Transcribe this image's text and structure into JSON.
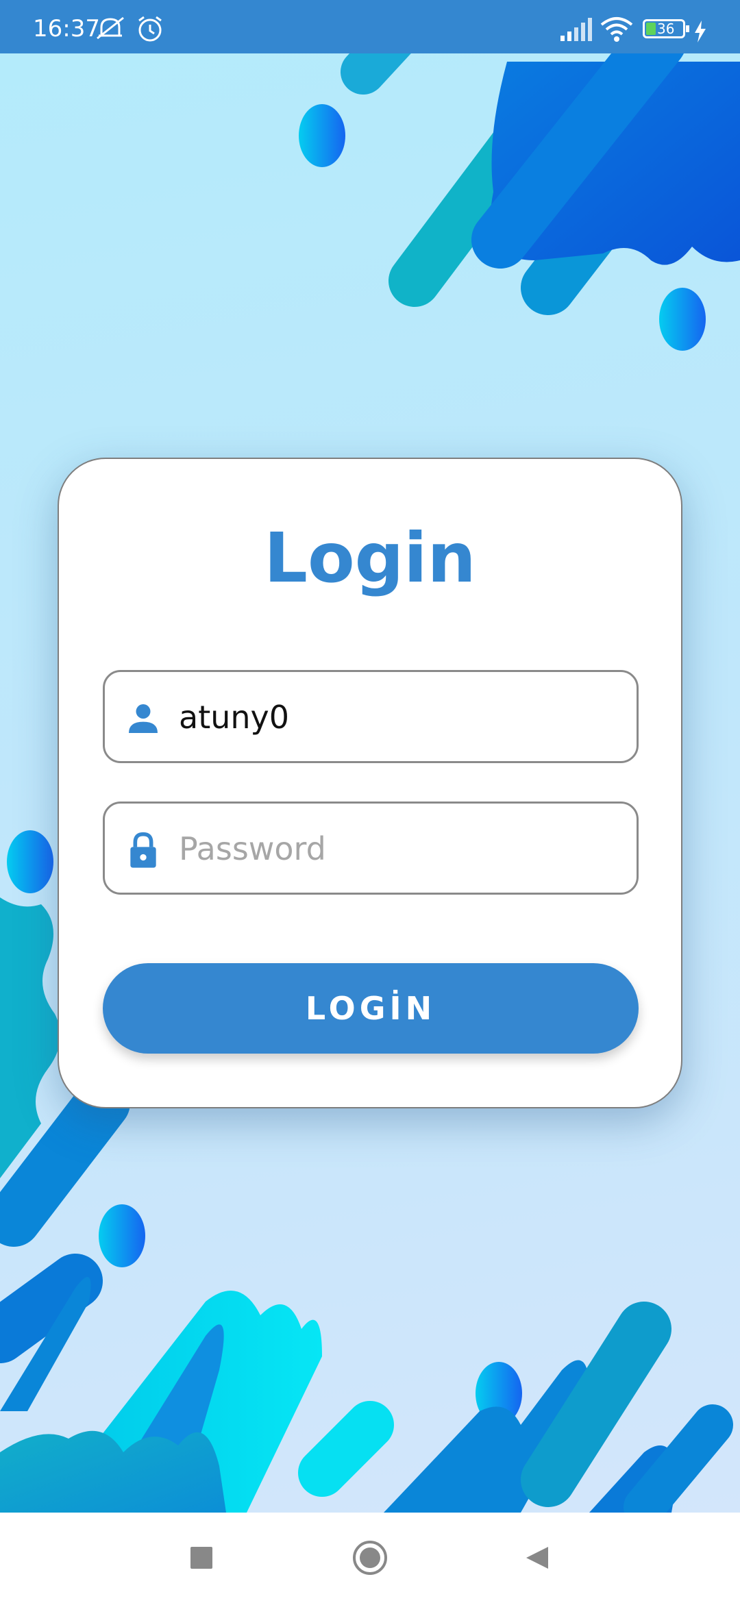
{
  "status_bar": {
    "time": "16:37",
    "battery_level": "36",
    "icons": [
      "mute-icon",
      "alarm-icon",
      "signal-icon",
      "wifi-icon",
      "battery-icon",
      "charging-icon"
    ]
  },
  "login": {
    "title": "Login",
    "username_value": "atuny0",
    "password_placeholder": "Password",
    "submit_label": "LOGİN",
    "username_icon": "person-icon",
    "password_icon": "lock-icon"
  },
  "nav_bar": {
    "icons": [
      "recents-square-icon",
      "home-circle-icon",
      "back-triangle-icon"
    ]
  },
  "colors": {
    "primary": "#3587d0",
    "status_bar": "#3487d0",
    "background_light": "#b4ebfb"
  }
}
